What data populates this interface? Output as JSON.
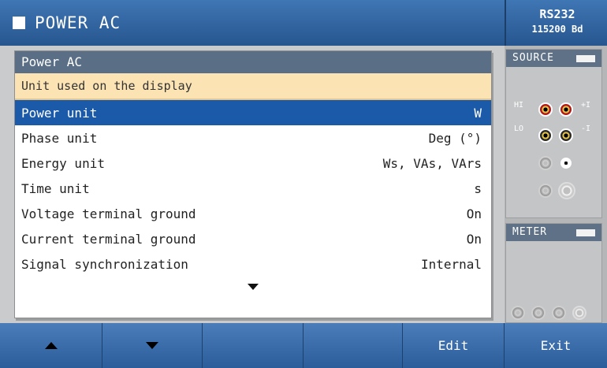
{
  "header": {
    "title": "POWER AC",
    "interface_name": "RS232",
    "baud_rate": "115200 Bd"
  },
  "dialog": {
    "title": "Power AC",
    "help_text": "Unit used on the display",
    "items": [
      {
        "label": "Power unit",
        "value": "W",
        "selected": true
      },
      {
        "label": "Phase unit",
        "value": "Deg (°)"
      },
      {
        "label": "Energy unit",
        "value": "Ws, VAs, VArs"
      },
      {
        "label": "Time unit",
        "value": "s"
      },
      {
        "label": "Voltage terminal ground",
        "value": "On"
      },
      {
        "label": "Current terminal ground",
        "value": "On"
      },
      {
        "label": "Signal synchronization",
        "value": "Internal"
      }
    ],
    "more_icon": "chevron-down-icon"
  },
  "side_panel": {
    "source_label": "SOURCE",
    "meter_label": "METER",
    "terminals": {
      "hi": "HI",
      "lo": "LO",
      "plus": "+I",
      "minus": "-I"
    }
  },
  "toolbar": {
    "up_icon": "arrow-up-icon",
    "down_icon": "arrow-down-icon",
    "edit_label": "Edit",
    "exit_label": "Exit"
  },
  "colors": {
    "title_bar": "#2f639f",
    "dialog_header": "#5a6f86",
    "help_bg": "#fbe3b4",
    "selection": "#1b5aa8"
  }
}
